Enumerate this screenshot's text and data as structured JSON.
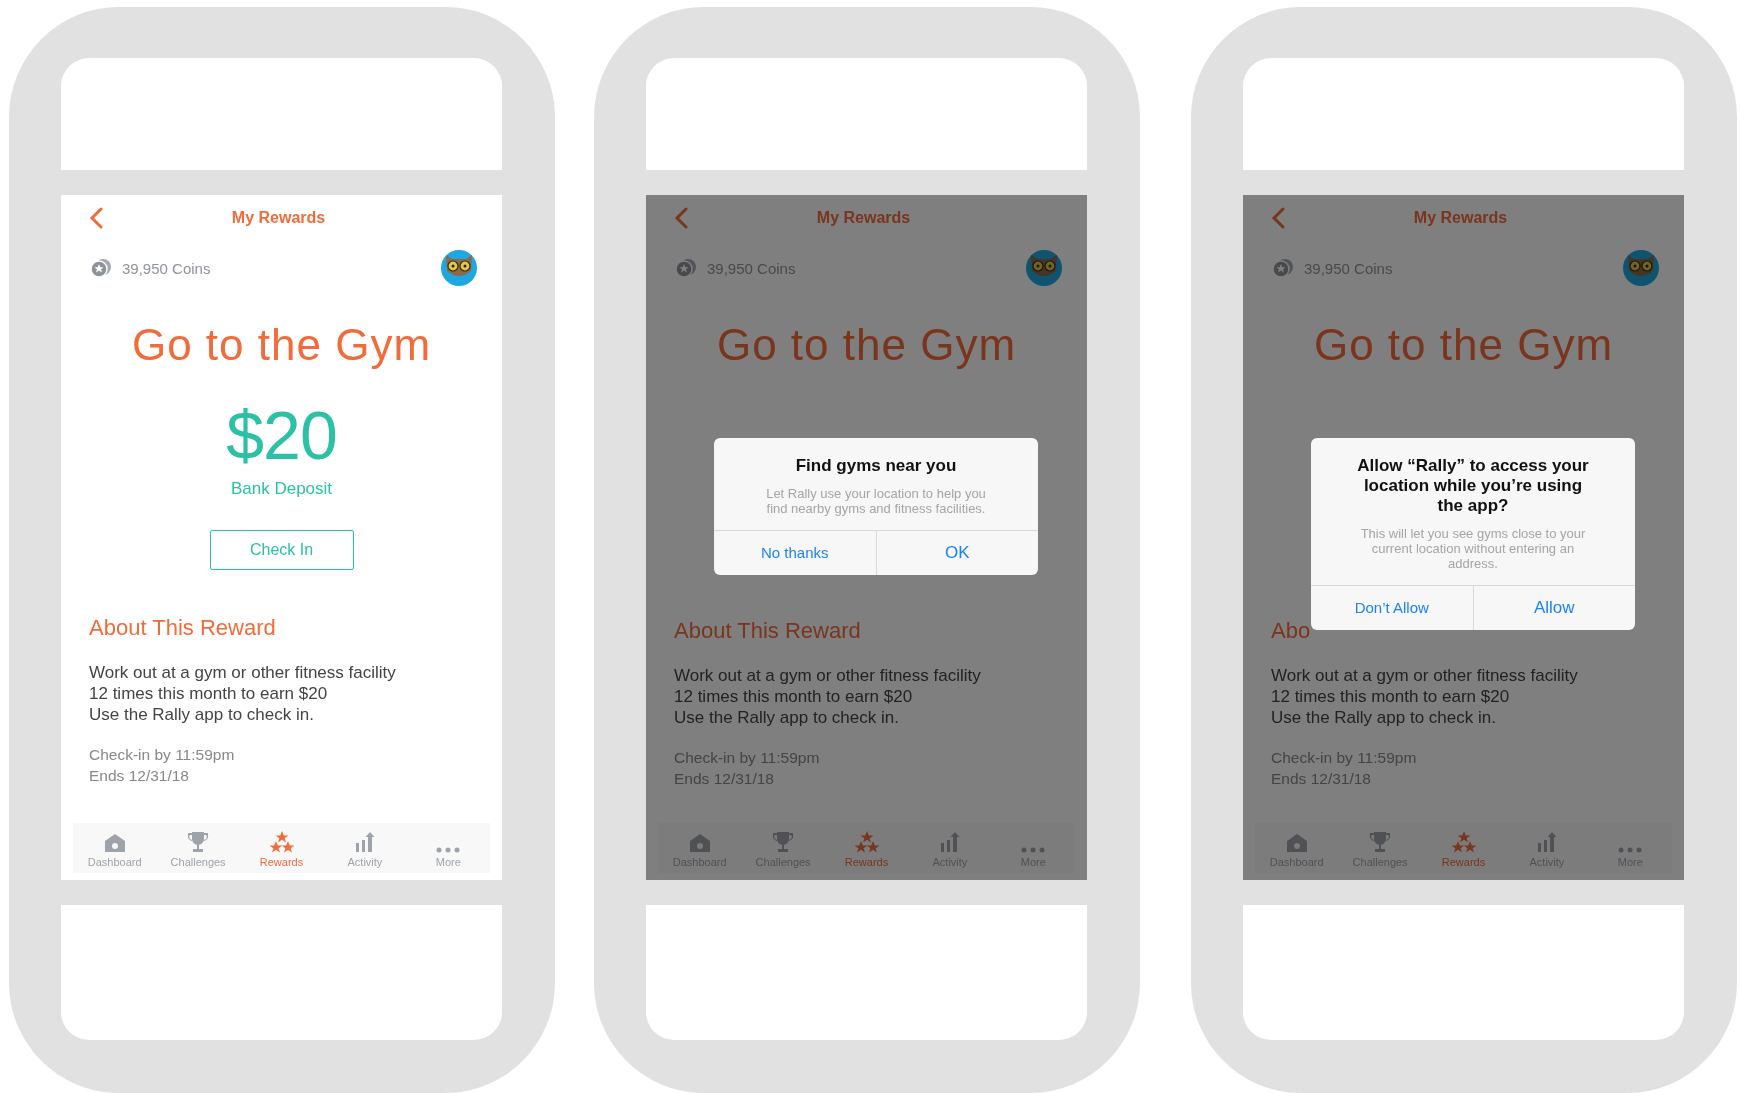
{
  "phones": [
    {
      "header": {
        "title": "My Rewards"
      },
      "coins": "39,950 Coins",
      "reward": {
        "title": "Go to the Gym",
        "amount": "$20",
        "method": "Bank Deposit",
        "button": "Check In"
      },
      "about": {
        "heading": "About This Reward",
        "lines": [
          "Work out at a gym or other fitness facility",
          "12 times this month to earn $20",
          "Use the Rally app to check in."
        ]
      },
      "deadline": [
        "Check-in by 11:59pm",
        "Ends 12/31/18"
      ],
      "tabs": [
        {
          "kind": "home",
          "label": "Dashboard",
          "selected": false
        },
        {
          "kind": "trophy",
          "label": "Challenges",
          "selected": false
        },
        {
          "kind": "stars",
          "label": "Rewards",
          "selected": true
        },
        {
          "kind": "activity",
          "label": "Activity",
          "selected": false
        },
        {
          "kind": "more",
          "label": "More",
          "selected": false
        }
      ]
    },
    {
      "header": {
        "title": "My Rewards"
      },
      "coins": "39,950 Coins",
      "reward": {
        "title": "Go to the Gym"
      },
      "about": {
        "heading": "About This Reward",
        "lines": [
          "Work out at a gym or other fitness facility",
          "12 times this month to earn $20",
          "Use the Rally app to check in."
        ]
      },
      "deadline": [
        "Check-in by 11:59pm",
        "Ends 12/31/18"
      ],
      "tabs": [
        {
          "kind": "home",
          "label": "Dashboard",
          "selected": false
        },
        {
          "kind": "trophy",
          "label": "Challenges",
          "selected": false
        },
        {
          "kind": "stars",
          "label": "Rewards",
          "selected": true
        },
        {
          "kind": "activity",
          "label": "Activity",
          "selected": false
        },
        {
          "kind": "more",
          "label": "More",
          "selected": false
        }
      ],
      "dialog": {
        "title": "Find gyms near you",
        "message": "Let Rally use your location to help you find nearby gyms and fitness facilities.",
        "buttons": [
          {
            "label": "No thanks",
            "bold": false
          },
          {
            "label": "OK",
            "bold": true
          }
        ]
      }
    },
    {
      "header": {
        "title": "My Rewards"
      },
      "coins": "39,950 Coins",
      "reward": {
        "title": "Go to the Gym"
      },
      "about": {
        "heading": "Abo",
        "lines": [
          "Work out at a gym or other fitness facility",
          "12 times this month to earn $20",
          "Use the Rally app to check in."
        ]
      },
      "deadline": [
        "Check-in by 11:59pm",
        "Ends 12/31/18"
      ],
      "tabs": [
        {
          "kind": "home",
          "label": "Dashboard",
          "selected": false
        },
        {
          "kind": "trophy",
          "label": "Challenges",
          "selected": false
        },
        {
          "kind": "stars",
          "label": "Rewards",
          "selected": true
        },
        {
          "kind": "activity",
          "label": "Activity",
          "selected": false
        },
        {
          "kind": "more",
          "label": "More",
          "selected": false
        }
      ],
      "dialog": {
        "title": "Allow “Rally” to access your location while you’re using the app?",
        "message": "This will let you see gyms close to your current location without entering an address.",
        "buttons": [
          {
            "label": "Don’t Allow",
            "bold": false
          },
          {
            "label": "Allow",
            "bold": true
          }
        ]
      }
    }
  ]
}
